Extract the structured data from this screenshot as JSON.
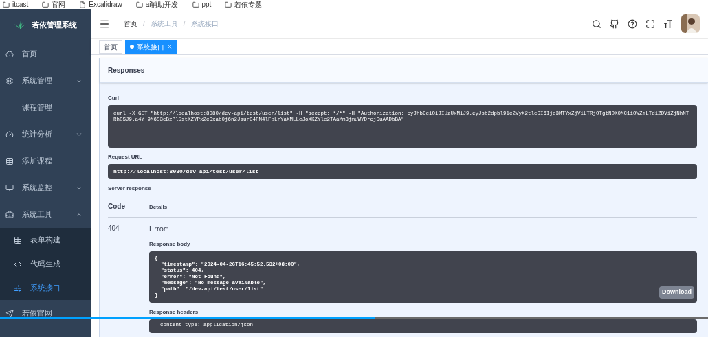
{
  "bookmarks": [
    {
      "kind": "folder",
      "label": "itcast"
    },
    {
      "kind": "folder",
      "label": "官网"
    },
    {
      "kind": "page",
      "label": "Excalidraw"
    },
    {
      "kind": "folder",
      "label": "ai辅助开发"
    },
    {
      "kind": "folder",
      "label": "ppt"
    },
    {
      "kind": "folder",
      "label": "若依专题"
    }
  ],
  "app_title": "若依管理系统",
  "sidebar": {
    "items": [
      {
        "kind": "item",
        "label": "首页",
        "selected": false
      },
      {
        "kind": "group",
        "label": "系统管理",
        "expanded": false
      },
      {
        "kind": "item",
        "label": "课程管理",
        "selected": false
      },
      {
        "kind": "group",
        "label": "统计分析",
        "expanded": false
      },
      {
        "kind": "item",
        "label": "添加课程",
        "selected": false
      },
      {
        "kind": "group",
        "label": "系统监控",
        "expanded": false
      },
      {
        "kind": "group",
        "label": "系统工具",
        "expanded": true,
        "children": [
          {
            "label": "表单构建",
            "selected": false
          },
          {
            "label": "代码生成",
            "selected": false
          },
          {
            "label": "系统接口",
            "selected": true
          }
        ]
      },
      {
        "kind": "item",
        "label": "若依官网",
        "selected": false
      }
    ]
  },
  "breadcrumb": [
    {
      "label": "首页"
    },
    {
      "label": "系统工具",
      "separator": "/"
    },
    {
      "label": "系统接口",
      "separator": "/"
    }
  ],
  "tags": [
    {
      "label": "首页",
      "selected": false
    },
    {
      "label": "系统接口",
      "selected": true
    }
  ],
  "content": {
    "section_title": "Responses",
    "curl_label": "Curl",
    "curl": "curl -X GET \"http://localhost:8080/dev-api/test/user/list\" -H \"accept: */*\" -H \"Authorization: eyJhbGciOiJIUzUxMiJ9.eyJsb2dpbl91c2VyX2tleSI6Ijc3MTYxZjViLTRjOTgtNDK0MC1iOWZmLTdiZDViZjNhNTRhOSJ9.a4Y_9M6S3eBzPl5stKZYPx2cGxab0j6n2Jsur04FM4lFpLrYaXMLLcJoXKZYlc2TAaMm3jmuWYDrejGuAADbBA\"",
    "request_url_label": "Request URL",
    "request_url": "http://localhost:8080/dev-api/test/user/list",
    "server_response_label": "Server response",
    "code_header": "Code",
    "details_header": "Details",
    "code": "404",
    "error": "Error:",
    "response_body_label": "Response body",
    "response_body": [
      "{",
      "  \"timestamp\": \"2024-04-26T16:45:52.532+08:00\",",
      "  \"status\": 404,",
      "  \"error\": \"Not Found\",",
      "  \"message\": \"No message available\",",
      "  \"path\": \"/dev-api/test/user/list\"",
      "}"
    ],
    "download": "Download",
    "response_headers_label": "Response headers",
    "response_headers": "content-type: application/json"
  },
  "video_progress": {
    "level": 0.53
  }
}
